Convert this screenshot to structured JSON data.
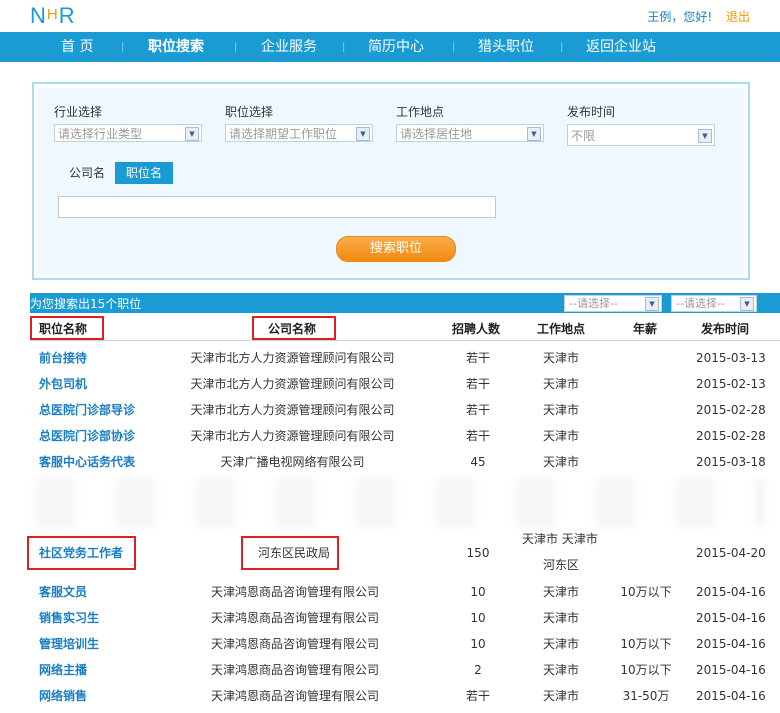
{
  "header": {
    "logo_left": "N",
    "logo_mid": "H",
    "logo_right": "R",
    "greeting": "王例，您好!",
    "logout": "退出"
  },
  "nav": {
    "items": [
      "首 页",
      "职位搜索",
      "企业服务",
      "简历中心",
      "猎头职位",
      "返回企业站"
    ]
  },
  "filters": {
    "industry": {
      "label": "行业选择",
      "placeholder": "请选择行业类型"
    },
    "position": {
      "label": "职位选择",
      "placeholder": "请选择期望工作职位"
    },
    "location": {
      "label": "工作地点",
      "placeholder": "请选择居住地"
    },
    "time": {
      "label": "发布时间",
      "value": "不限"
    },
    "tabs": [
      "公司名",
      "职位名"
    ],
    "search_button": "搜索职位"
  },
  "results": {
    "count_text": "为您搜索出15个职位",
    "sort1": "--请选择--",
    "sort2": "--请选择--",
    "headers": [
      "职位名称",
      "公司名称",
      "招聘人数",
      "工作地点",
      "年薪",
      "发布时间"
    ],
    "rows": [
      {
        "title": "前台接待",
        "company": "天津市北方人力资源管理顾问有限公司",
        "count": "若干",
        "location": "天津市",
        "salary": "",
        "date": "2015-03-13"
      },
      {
        "title": "外包司机",
        "company": "天津市北方人力资源管理顾问有限公司",
        "count": "若干",
        "location": "天津市",
        "salary": "",
        "date": "2015-02-13"
      },
      {
        "title": "总医院门诊部导诊",
        "company": "天津市北方人力资源管理顾问有限公司",
        "count": "若干",
        "location": "天津市",
        "salary": "",
        "date": "2015-02-28"
      },
      {
        "title": "总医院门诊部协诊",
        "company": "天津市北方人力资源管理顾问有限公司",
        "count": "若干",
        "location": "天津市",
        "salary": "",
        "date": "2015-02-28"
      },
      {
        "title": "客服中心话务代表",
        "company": "天津广播电视网络有限公司",
        "count": "45",
        "location": "天津市",
        "salary": "",
        "date": "2015-03-18"
      }
    ],
    "highlight_row": {
      "title": "社区党务工作者",
      "company": "河东区民政局",
      "count": "150",
      "location_line1": "天津市 天津市",
      "location_line2": "河东区",
      "date": "2015-04-20"
    },
    "rows2": [
      {
        "title": "客服文员",
        "company": "天津鸿恩商品咨询管理有限公司",
        "count": "10",
        "location": "天津市",
        "salary": "10万以下",
        "date": "2015-04-16"
      },
      {
        "title": "销售实习生",
        "company": "天津鸿恩商品咨询管理有限公司",
        "count": "10",
        "location": "天津市",
        "salary": "",
        "date": "2015-04-16"
      },
      {
        "title": "管理培训生",
        "company": "天津鸿恩商品咨询管理有限公司",
        "count": "10",
        "location": "天津市",
        "salary": "10万以下",
        "date": "2015-04-16"
      },
      {
        "title": "网络主播",
        "company": "天津鸿恩商品咨询管理有限公司",
        "count": "2",
        "location": "天津市",
        "salary": "10万以下",
        "date": "2015-04-16"
      },
      {
        "title": "网络销售",
        "company": "天津鸿恩商品咨询管理有限公司",
        "count": "若干",
        "location": "天津市",
        "salary": "31-50万",
        "date": "2015-04-16"
      }
    ]
  },
  "colors": {
    "brand": "#1a9bd4",
    "accent": "#f39800",
    "highlight": "#e02020"
  }
}
